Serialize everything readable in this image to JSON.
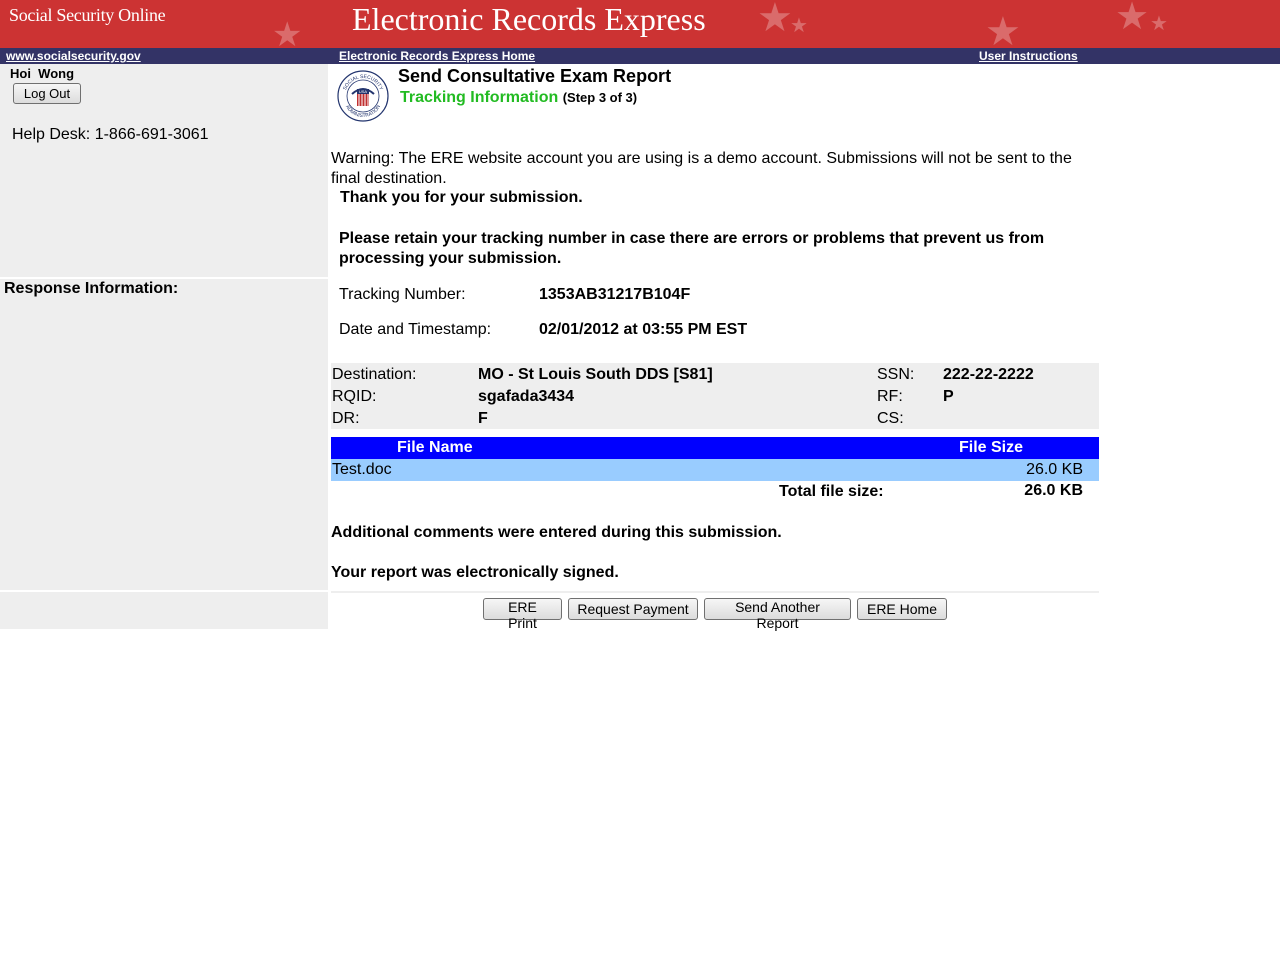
{
  "header": {
    "site_name": "Social Security Online",
    "app_title": "Electronic Records Express",
    "colors": {
      "banner": "#cc3333",
      "navbar": "#333366"
    }
  },
  "nav": {
    "left_link": "www.socialsecurity.gov",
    "home_link": "Electronic Records Express Home",
    "instructions_link": "User Instructions"
  },
  "sidebar": {
    "user_name": "Hoi  Wong",
    "logout_label": "Log Out",
    "helpdesk": "Help Desk: 1-866-691-3061",
    "response_label": "Response Information:"
  },
  "main": {
    "title": "Send Consultative Exam Report",
    "step_title": "Tracking Information",
    "step_note": "(Step 3 of 3)",
    "warning": "Warning: The ERE website account you are using is a demo account. Submissions will not be sent to the final destination.",
    "thanks": "Thank you for your submission.",
    "retain_note": "Please retain your tracking number in case there are errors or problems that prevent us from processing your submission.",
    "tracking_label": "Tracking Number:",
    "tracking_value": "1353AB31217B104F",
    "timestamp_label": "Date and Timestamp:",
    "timestamp_value": "02/01/2012 at 03:55 PM EST"
  },
  "details": {
    "destination_label": "Destination:",
    "destination_value": "MO - St Louis South DDS [S81]",
    "rqid_label": "RQID:",
    "rqid_value": "sgafada3434",
    "dr_label": "DR:",
    "dr_value": "F",
    "ssn_label": "SSN:",
    "ssn_value": "222-22-2222",
    "rf_label": "RF:",
    "rf_value": "P",
    "cs_label": "CS:",
    "cs_value": ""
  },
  "files": {
    "col_name": "File Name",
    "col_size": "File Size",
    "rows": [
      {
        "name": "Test.doc",
        "size": "26.0 KB"
      }
    ],
    "total_label": "Total file size:",
    "total_value": "26.0 KB"
  },
  "notes": {
    "comments": "Additional comments were entered during this submission.",
    "signed": "Your report was electronically signed."
  },
  "buttons": {
    "print": "ERE Print",
    "request_payment": "Request Payment",
    "send_another": "Send Another Report",
    "home": "ERE Home"
  },
  "logo": {
    "top_text": "SOCIAL SECURITY",
    "bottom_text": "ADMINISTRATION",
    "center_text": "USA"
  }
}
